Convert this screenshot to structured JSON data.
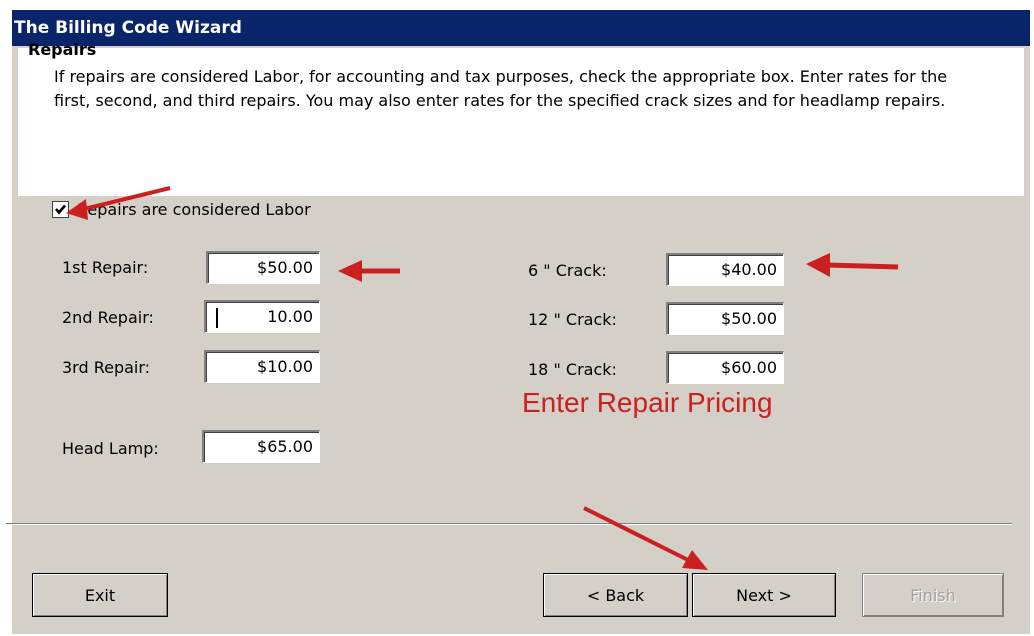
{
  "window": {
    "title": "The Billing Code Wizard"
  },
  "header": {
    "title": "Repairs",
    "description": "If repairs are considered Labor, for accounting and tax purposes, check the appropriate box.  Enter rates for the first, second, and third repairs.  You may also enter rates for the specified crack sizes and for headlamp repairs."
  },
  "labor_checkbox": {
    "label": "Repairs are considered Labor",
    "checked": true
  },
  "repairs": [
    {
      "label": "1st Repair:",
      "value": "$50.00"
    },
    {
      "label": "2nd Repair:",
      "value": "10.00"
    },
    {
      "label": "3rd Repair:",
      "value": "$10.00"
    }
  ],
  "head_lamp": {
    "label": "Head Lamp:",
    "value": "$65.00"
  },
  "cracks": [
    {
      "label": "6 \"  Crack:",
      "value": "$40.00"
    },
    {
      "label": "12 \"  Crack:",
      "value": "$50.00"
    },
    {
      "label": "18 \"  Crack:",
      "value": "$60.00"
    }
  ],
  "annotation": {
    "text": "Enter Repair Pricing",
    "color": "#cc1f1f"
  },
  "buttons": {
    "exit": "Exit",
    "back": "< Back",
    "next": "Next >",
    "finish": "Finish"
  },
  "colors": {
    "titlebar": "#0a246a",
    "dialog_bg": "#d4d0c8",
    "arrow": "#cc1f1f"
  }
}
